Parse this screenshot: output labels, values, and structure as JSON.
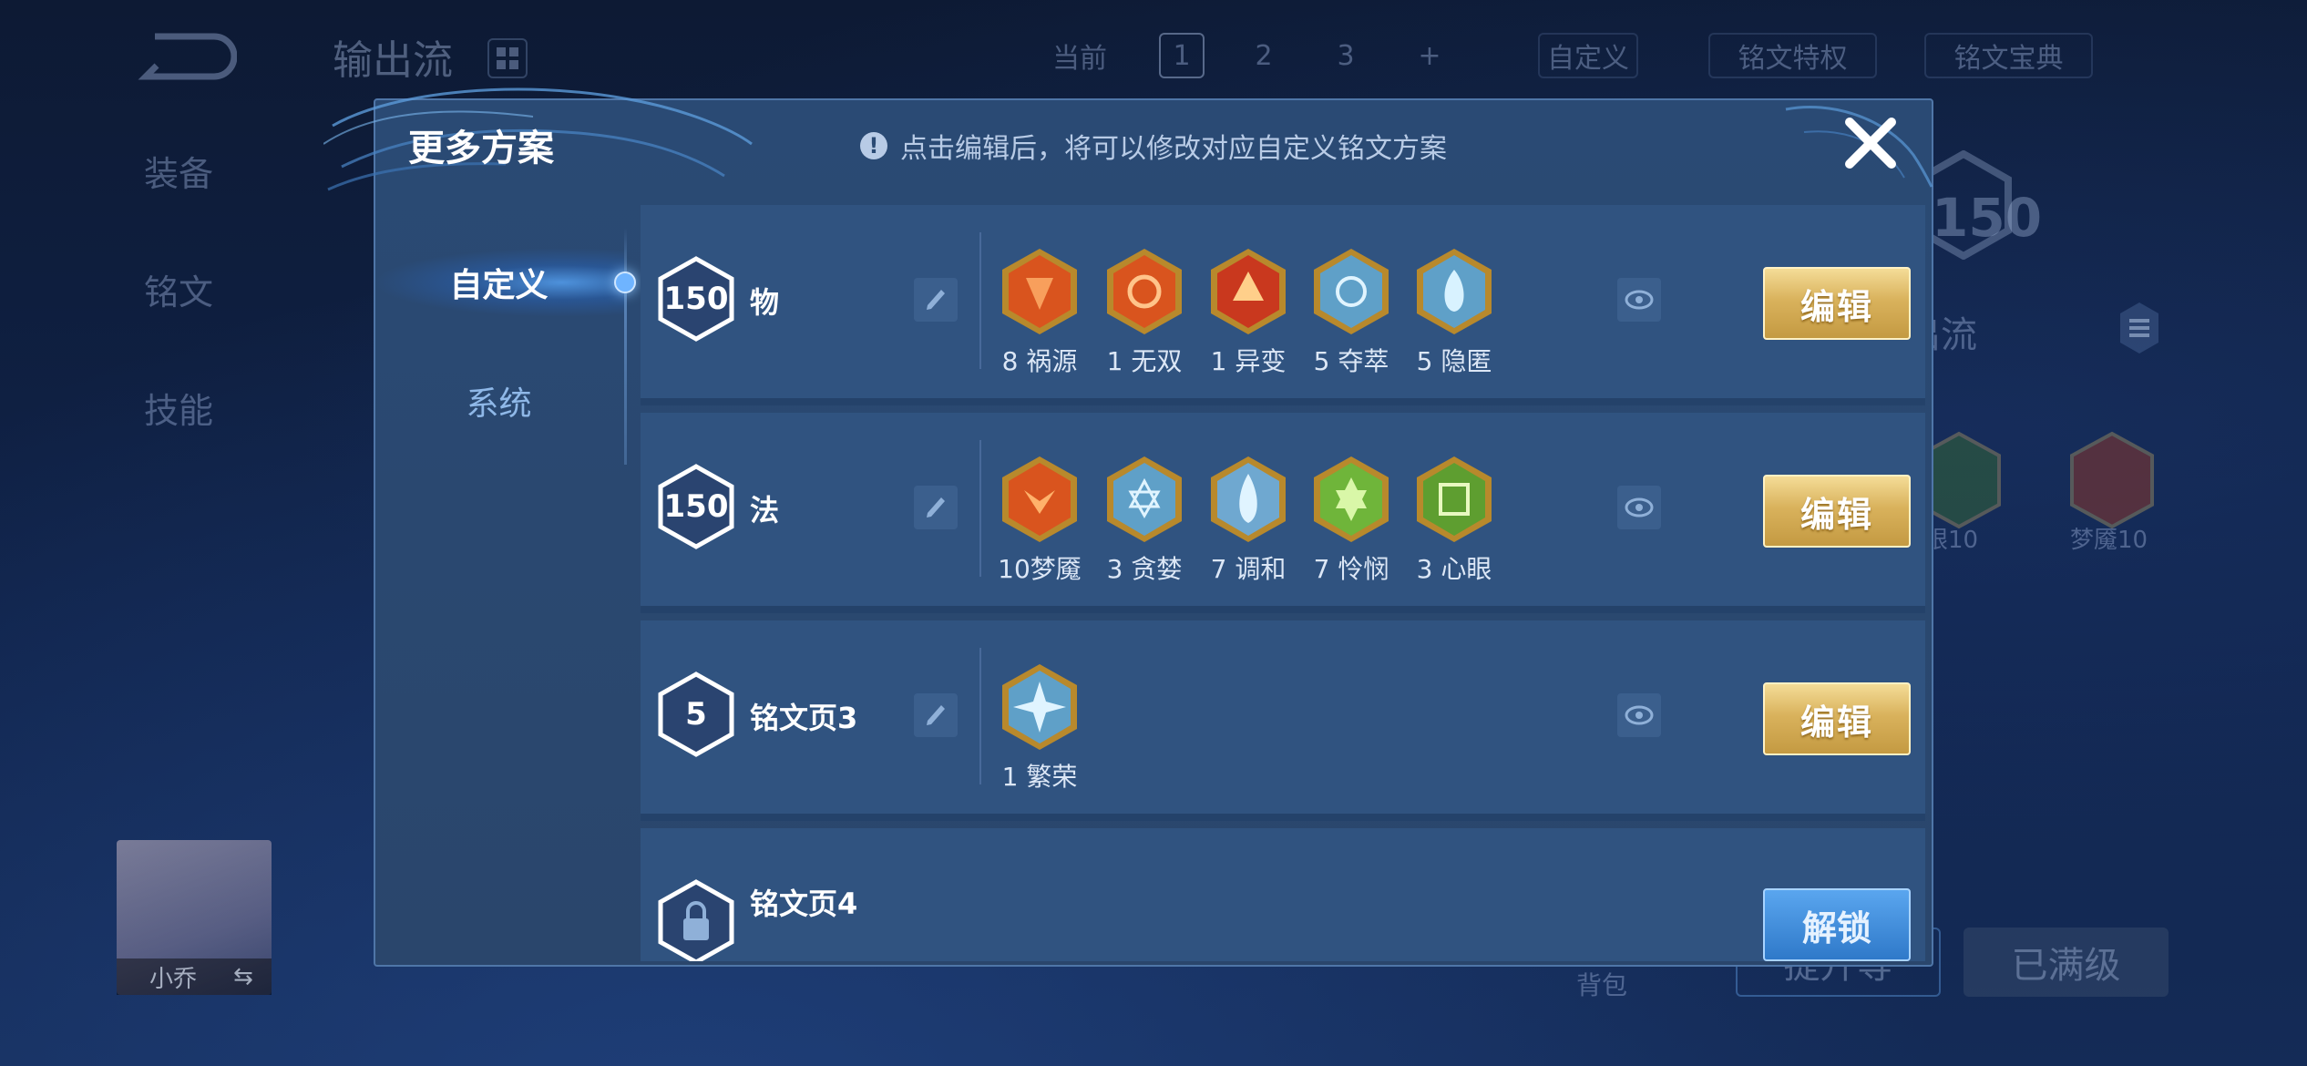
{
  "background": {
    "title": "输出流",
    "topbar": {
      "current": "当前",
      "pages": [
        "1",
        "2",
        "3"
      ],
      "add": "+",
      "custom": "自定义",
      "privilege": "铭文特权",
      "codex": "铭文宝典"
    },
    "side_nav": [
      "装备",
      "铭文",
      "技能"
    ],
    "level": "150",
    "subtitle": "出流",
    "runes": [
      {
        "label": "眼10"
      },
      {
        "label": "梦魇10"
      }
    ],
    "hero_name": "小乔",
    "bag": "背包",
    "btn_left": "提升等",
    "btn_right": "已满级"
  },
  "dialog": {
    "title": "更多方案",
    "hint": "点击编辑后，将可以修改对应自定义铭文方案",
    "tabs": [
      "自定义",
      "系统"
    ],
    "rows": [
      {
        "level": "150",
        "name": "物",
        "button": "编辑",
        "runes": [
          {
            "label": "8 祸源",
            "color": "#d9541e"
          },
          {
            "label": "1 无双",
            "color": "#d9541e"
          },
          {
            "label": "1 异变",
            "color": "#c9381e"
          },
          {
            "label": "5 夺萃",
            "color": "#5fa0c8"
          },
          {
            "label": "5 隐匿",
            "color": "#5fa0c8"
          }
        ]
      },
      {
        "level": "150",
        "name": "法",
        "button": "编辑",
        "runes": [
          {
            "label": "10梦魇",
            "color": "#d9541e"
          },
          {
            "label": "3 贪婪",
            "color": "#5fa0c8"
          },
          {
            "label": "7 调和",
            "color": "#5fa0c8"
          },
          {
            "label": "7 怜悯",
            "color": "#6fb53a"
          },
          {
            "label": "3 心眼",
            "color": "#6fb53a"
          }
        ]
      },
      {
        "level": "5",
        "name": "铭文页3",
        "button": "编辑",
        "runes": [
          {
            "label": "1 繁荣",
            "color": "#5fa0c8"
          }
        ]
      },
      {
        "name": "铭文页4",
        "button": "解锁",
        "locked": true
      }
    ]
  }
}
